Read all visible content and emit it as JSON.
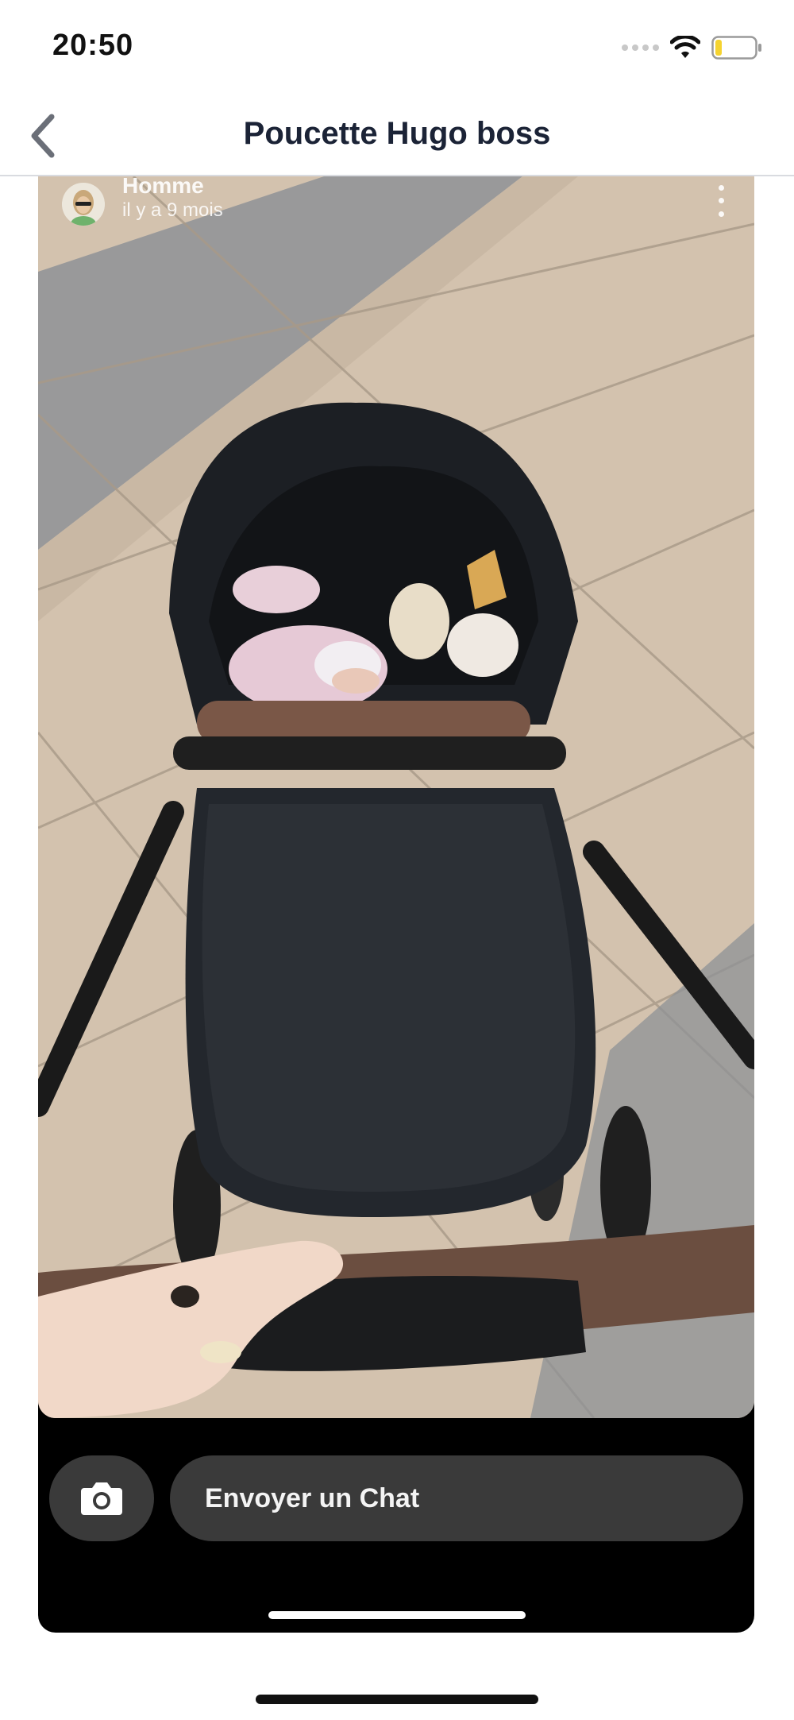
{
  "status_bar": {
    "time": "20:50",
    "icons": [
      "signal-dots-icon",
      "wifi-icon",
      "battery-low-icon"
    ],
    "battery_color": "#f5d330"
  },
  "nav": {
    "title": "Poucette Hugo boss",
    "back_icon": "chevron-left-icon"
  },
  "story": {
    "username": "Homme",
    "posted": "il y a 9 mois",
    "more_icon": "more-vertical-icon",
    "image_description_icon": "photo-stroller"
  },
  "chat_bar": {
    "camera_icon": "camera-icon",
    "placeholder": "Envoyer un Chat"
  },
  "colors": {
    "nav_title": "#1b2336",
    "chat_bg": "#3a3a3a",
    "card_bg": "#000000"
  }
}
